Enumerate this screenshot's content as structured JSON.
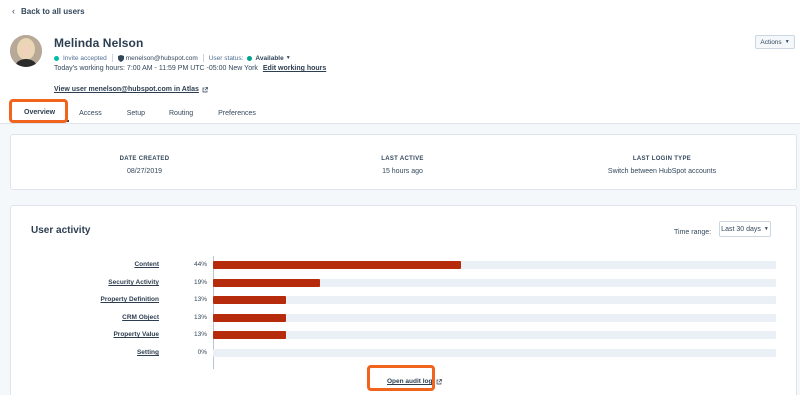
{
  "nav": {
    "back_label": "Back to all users"
  },
  "user": {
    "name": "Melinda Nelson",
    "invite_status": "Invite accepted",
    "email": "menelson@hubspot.com",
    "status_label": "User status:",
    "status_value": "Available",
    "working_hours": "Today's working hours: 7:00 AM - 11:59 PM UTC -05:00 New York",
    "edit_hours_label": "Edit working hours",
    "atlas_link": "View user menelson@hubspot.com in Atlas"
  },
  "actions_label": "Actions",
  "tabs": [
    {
      "label": "Overview",
      "active": true
    },
    {
      "label": "Access",
      "active": false
    },
    {
      "label": "Setup",
      "active": false
    },
    {
      "label": "Routing",
      "active": false
    },
    {
      "label": "Preferences",
      "active": false
    }
  ],
  "stats": [
    {
      "label": "DATE CREATED",
      "value": "08/27/2019"
    },
    {
      "label": "LAST ACTIVE",
      "value": "15 hours ago"
    },
    {
      "label": "LAST LOGIN TYPE",
      "value": "Switch between HubSpot accounts"
    }
  ],
  "activity": {
    "title": "User activity",
    "time_range_label": "Time range:",
    "time_range_value": "Last 30 days",
    "rows": [
      {
        "label": "Content",
        "pct": "44%",
        "value": 44
      },
      {
        "label": "Security Activity",
        "pct": "19%",
        "value": 19
      },
      {
        "label": "Property Definition",
        "pct": "13%",
        "value": 13
      },
      {
        "label": "CRM Object",
        "pct": "13%",
        "value": 13
      },
      {
        "label": "Property Value",
        "pct": "13%",
        "value": 13
      },
      {
        "label": "Setting",
        "pct": "0%",
        "value": 0
      }
    ],
    "audit_link": "Open audit log"
  },
  "colors": {
    "bar_fill": "#b52b0c",
    "highlight": "#f0641e",
    "available": "#00a38d"
  }
}
